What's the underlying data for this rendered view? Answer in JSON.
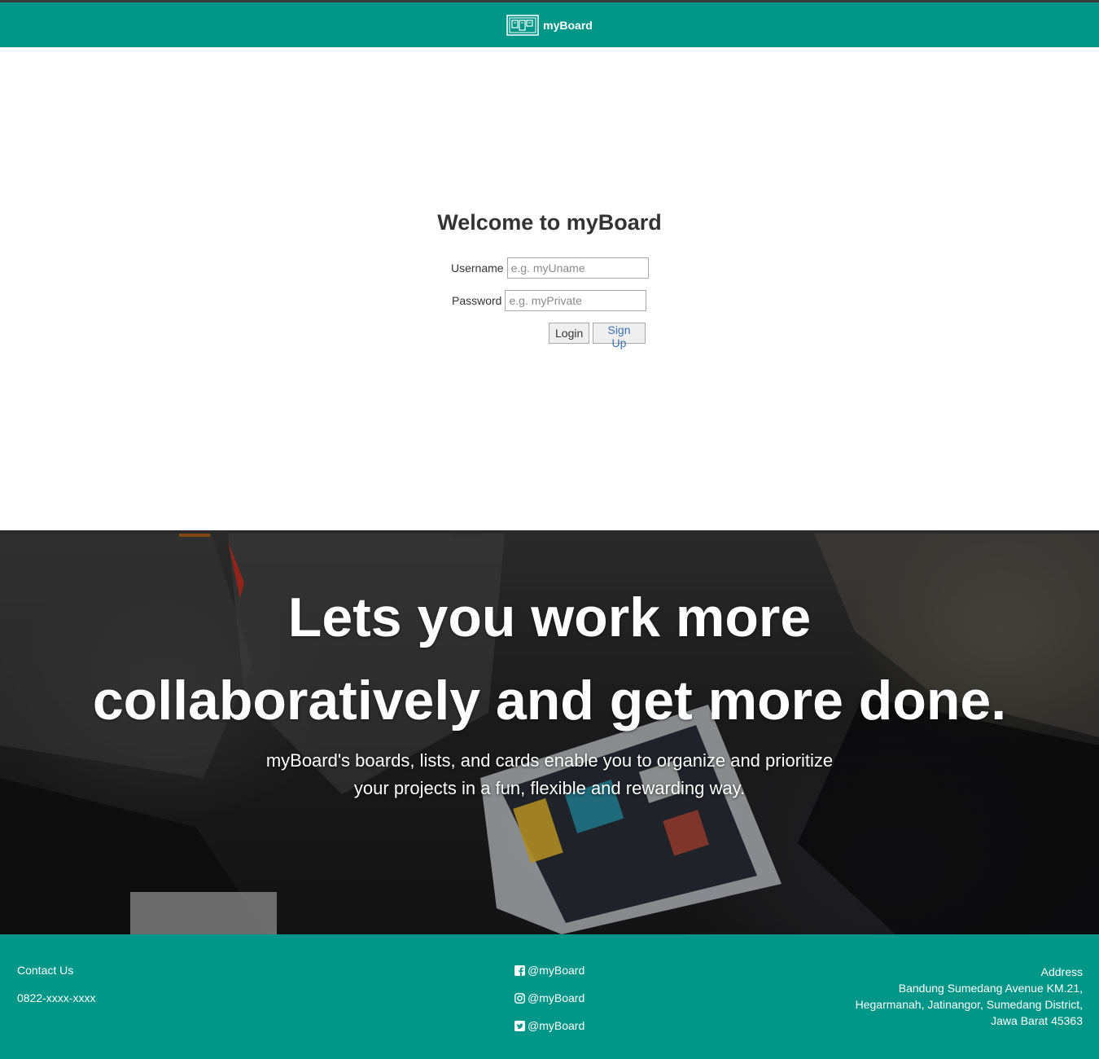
{
  "header": {
    "brand_name": "myBoard",
    "logo_icon": "board-logo-icon",
    "background_color": "#009688"
  },
  "login": {
    "title": "Welcome to myBoard",
    "username_label": "Username",
    "username_placeholder": "e.g. myUname",
    "password_label": "Password",
    "password_placeholder": "e.g. myPrivate",
    "login_button": "Login",
    "signup_button": "Sign Up"
  },
  "hero": {
    "headline_line1": "Lets you work more",
    "headline_line2": "collaboratively and get more done.",
    "subtext_line1": "myBoard's boards, lists, and cards enable you to organize and prioritize",
    "subtext_line2": "your projects in a fun, flexible and rewarding way."
  },
  "footer": {
    "contact_label": "Contact Us",
    "phone": "0822-xxxx-xxxx",
    "facebook": "@myBoard",
    "instagram": "@myBoard",
    "twitter": "@myBoard",
    "address_label": "Address",
    "address_line1": "Bandung Sumedang Avenue KM.21,",
    "address_line2": "Hegarmanah, Jatinangor, Sumedang District,",
    "address_line3": "Jawa Barat 45363",
    "background_color": "#009688"
  }
}
